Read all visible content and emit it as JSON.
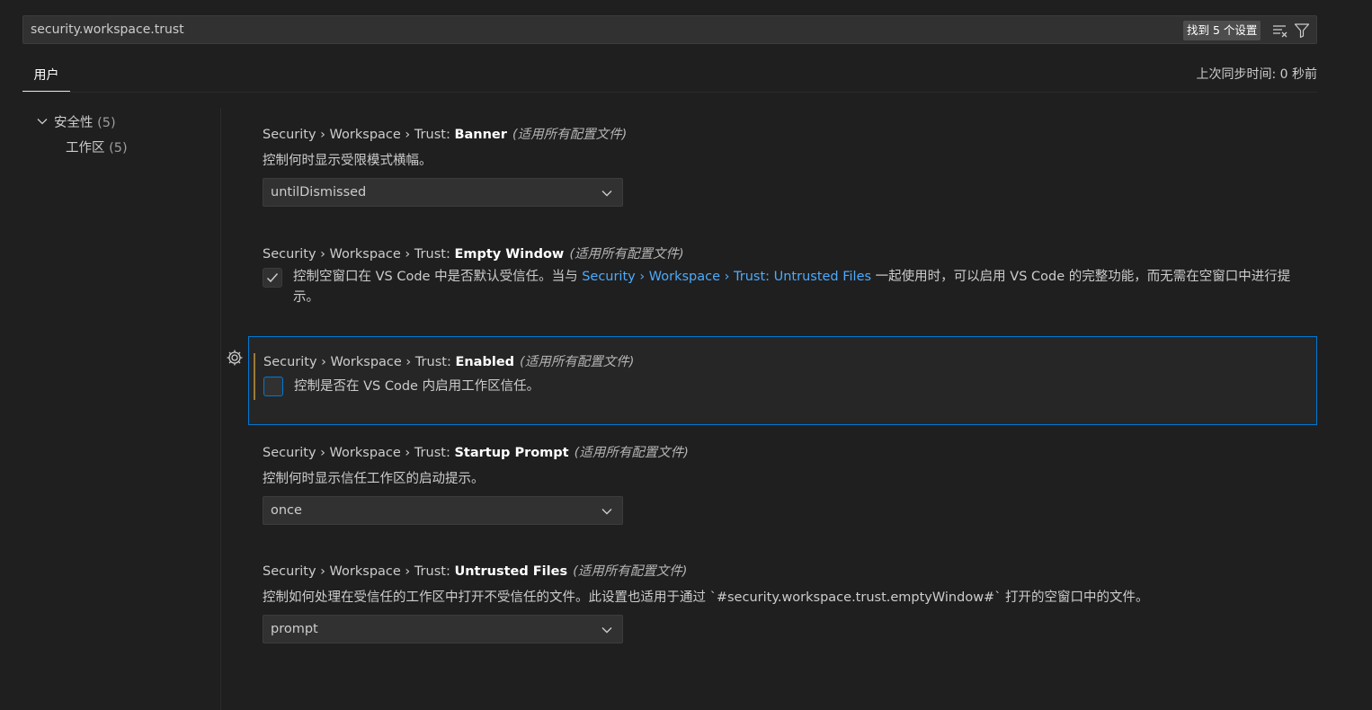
{
  "search": {
    "value": "security.workspace.trust",
    "result_count": "找到 5 个设置"
  },
  "tabs": {
    "user_label": "用户",
    "sync_status": "上次同步时间: 0 秒前"
  },
  "toc": {
    "items": [
      {
        "label": "安全性",
        "count": "(5)"
      },
      {
        "label": "工作区",
        "count": "(5)"
      }
    ]
  },
  "settings": [
    {
      "prefix": "Security › Workspace › Trust: ",
      "key": "Banner",
      "scope": "(适用所有配置文件)",
      "description": "控制何时显示受限模式横幅。",
      "value": "untilDismissed"
    },
    {
      "prefix": "Security › Workspace › Trust: ",
      "key": "Empty Window",
      "scope": "(适用所有配置文件)",
      "desc_before": "控制空窗口在 VS Code 中是否默认受信任。当与 ",
      "desc_link": "Security › Workspace › Trust: Untrusted Files",
      "desc_after": " 一起使用时，可以启用 VS Code 的完整功能，而无需在空窗口中进行提示。",
      "checked": true
    },
    {
      "prefix": "Security › Workspace › Trust: ",
      "key": "Enabled",
      "scope": "(适用所有配置文件)",
      "description": "控制是否在 VS Code 内启用工作区信任。",
      "checked": false
    },
    {
      "prefix": "Security › Workspace › Trust: ",
      "key": "Startup Prompt",
      "scope": "(适用所有配置文件)",
      "description": "控制何时显示信任工作区的启动提示。",
      "value": "once"
    },
    {
      "prefix": "Security › Workspace › Trust: ",
      "key": "Untrusted Files",
      "scope": "(适用所有配置文件)",
      "description": "控制如何处理在受信任的工作区中打开不受信任的文件。此设置也适用于通过 `#security.workspace.trust.emptyWindow#` 打开的空窗口中的文件。",
      "value": "prompt"
    }
  ],
  "colors": {
    "accent": "#0078d4",
    "link": "#4daafc",
    "background": "#1f1f1f"
  }
}
